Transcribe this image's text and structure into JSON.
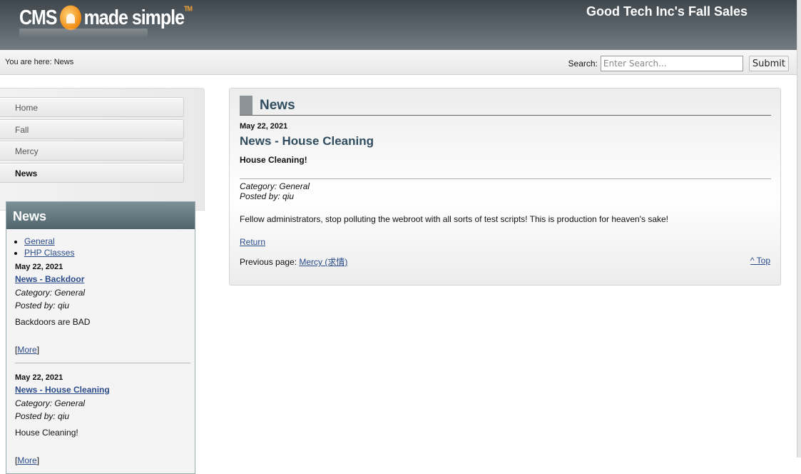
{
  "header": {
    "logo_text": "CMS Made Simple",
    "logo_left": "CMS",
    "logo_right": "made simple",
    "logo_tm": "TM",
    "site_title": "Good Tech Inc's Fall Sales"
  },
  "breadcrumb": {
    "text": "You are here: News"
  },
  "search": {
    "label": "Search:",
    "placeholder": "Enter Search...",
    "button": "Submit"
  },
  "menu": {
    "items": [
      {
        "label": "Home",
        "active": false
      },
      {
        "label": "Fall",
        "active": false
      },
      {
        "label": "Mercy",
        "active": false
      },
      {
        "label": "News",
        "active": true
      }
    ]
  },
  "sidebar_news": {
    "heading": "News",
    "categories": [
      "General",
      "PHP Classes"
    ],
    "items": [
      {
        "date": "May 22, 2021",
        "title": "News - Backdoor",
        "category": "Category: General",
        "posted": "Posted by: qiu",
        "summary": "Backdoors are BAD",
        "more_open": "[",
        "more": "More",
        "more_close": "]"
      },
      {
        "date": "May 22, 2021",
        "title": "News - House Cleaning",
        "category": "Category: General",
        "posted": "Posted by: qiu",
        "summary": "House Cleaning!",
        "more_open": "[",
        "more": "More",
        "more_close": "]"
      }
    ]
  },
  "article": {
    "section": "News",
    "date": "May 22, 2021",
    "title": "News - House Cleaning",
    "summary": "House Cleaning!",
    "category": "Category: General",
    "posted": "Posted by: qiu",
    "body": "Fellow administrators, stop polluting the webroot with all sorts of test scripts! This is production for heaven's sake!",
    "return": "Return",
    "prev_label": "Previous page: ",
    "prev_link": "Mercy (求情)",
    "top": "^ Top"
  },
  "colors": {
    "header_dark": "#3f474d",
    "title_blue": "#2f4d5e",
    "link": "#2a4c8a",
    "sidebar_head": "#51666c"
  }
}
